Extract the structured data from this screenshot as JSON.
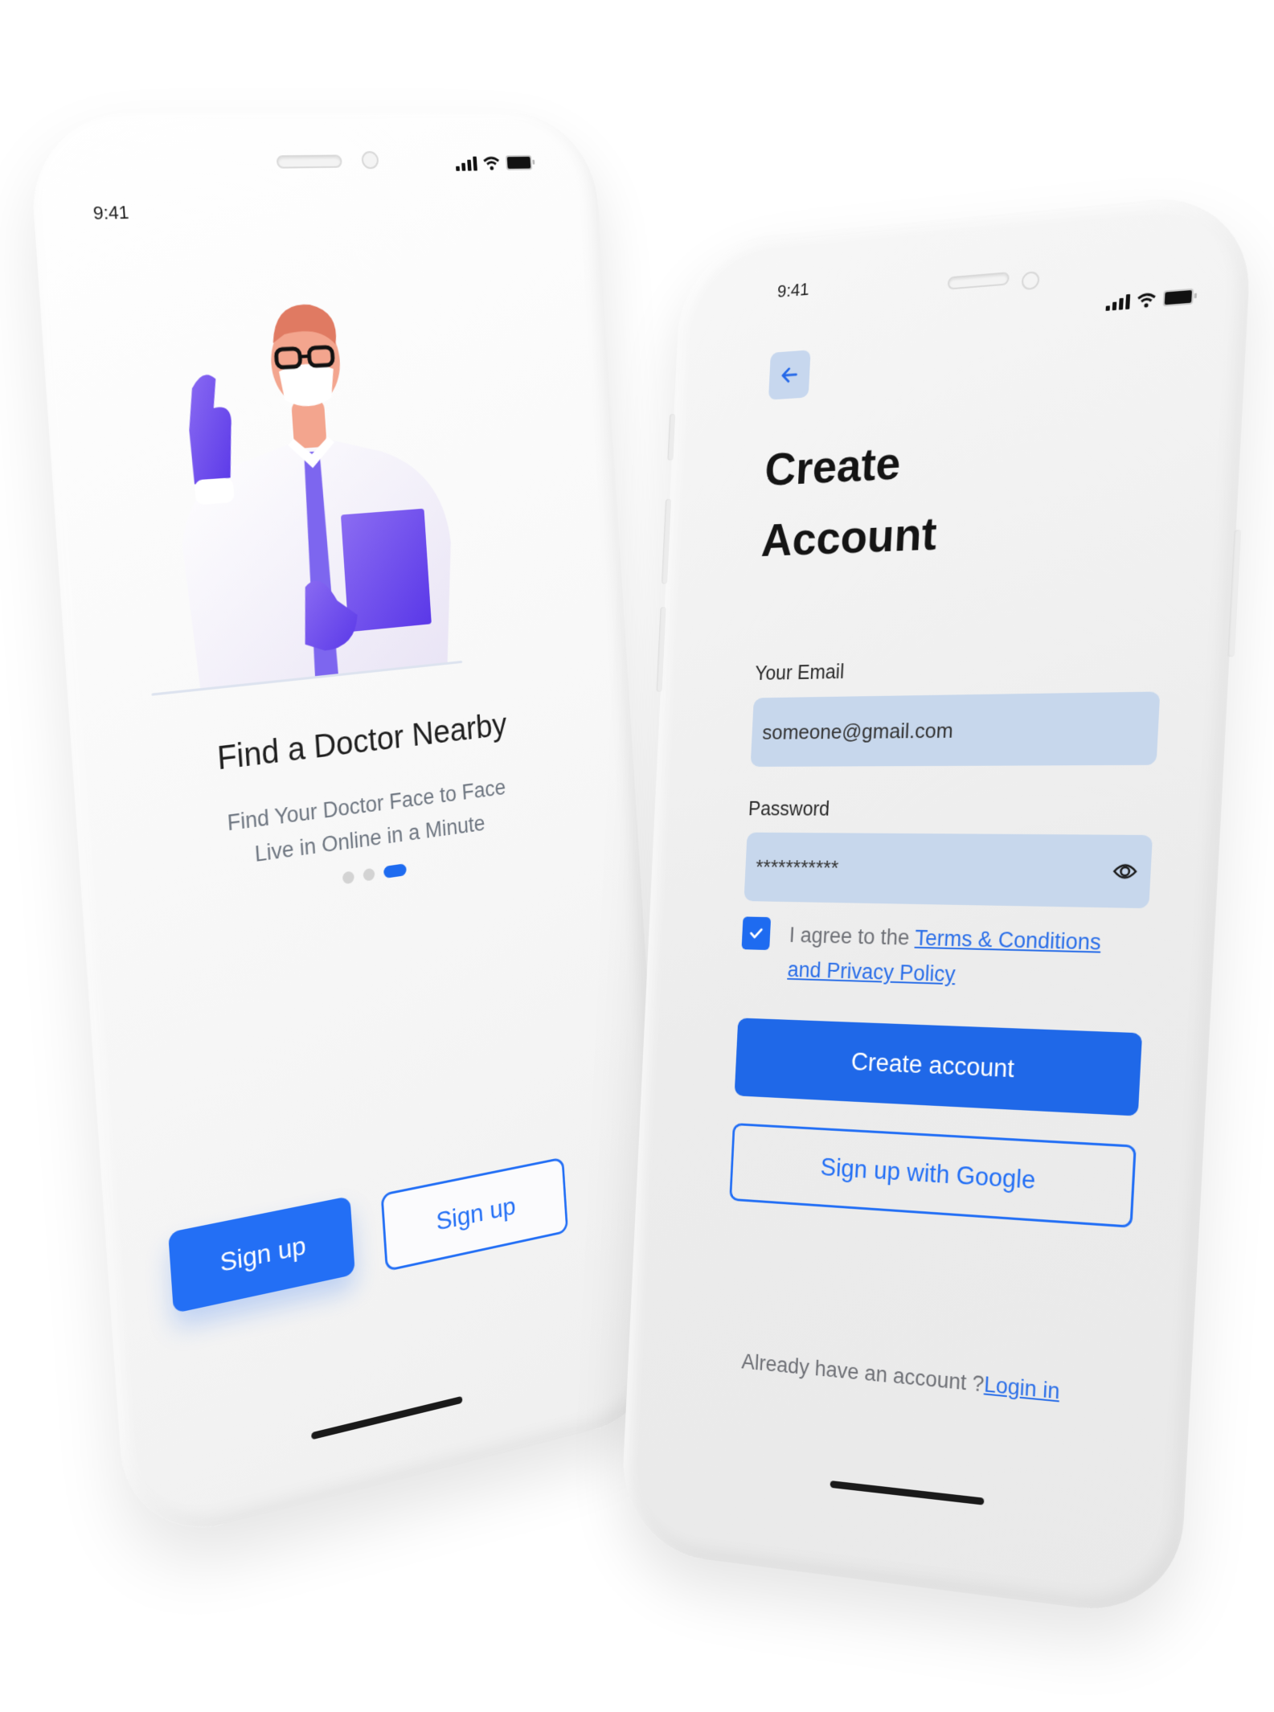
{
  "left_phone": {
    "status_bar": {
      "time": "9:41",
      "icons": [
        "cellular-signal-icon",
        "wifi-icon",
        "battery-icon"
      ]
    },
    "illustration": "doctor-illustration",
    "title": "Find a Doctor Nearby",
    "subtitle_line1": "Find Your Doctor Face to Face",
    "subtitle_line2": "Live in Online in a Minute",
    "pagination": {
      "total": 3,
      "active_index": 2
    },
    "buttons": {
      "primary_label": "Sign up",
      "secondary_label": "Sign up"
    }
  },
  "right_phone": {
    "status_bar": {
      "time": "9:41",
      "icons": [
        "cellular-signal-icon",
        "wifi-icon",
        "battery-icon"
      ]
    },
    "back_icon": "arrow-left-icon",
    "title_line1": "Create",
    "title_line2": "Account",
    "email": {
      "label": "Your Email",
      "value": "someone@gmail.com"
    },
    "password": {
      "label": "Password",
      "value": "***********",
      "toggle_icon": "eye-icon"
    },
    "agreement": {
      "checked": true,
      "prefix": "I agree to the ",
      "link1": "Terms & Conditions",
      "link2": "and Privacy Policy"
    },
    "create_button": "Create account",
    "google_button": "Sign up with Google",
    "footer": {
      "text": "Already have an account ?",
      "link": "Login in"
    }
  },
  "colors": {
    "accent": "#1f68e8",
    "input_bg": "#c7d7ec",
    "dot_inactive": "#d3d3d3",
    "screen_left_bg": "#f7f7f7",
    "screen_right_bg": "#ebebeb"
  }
}
